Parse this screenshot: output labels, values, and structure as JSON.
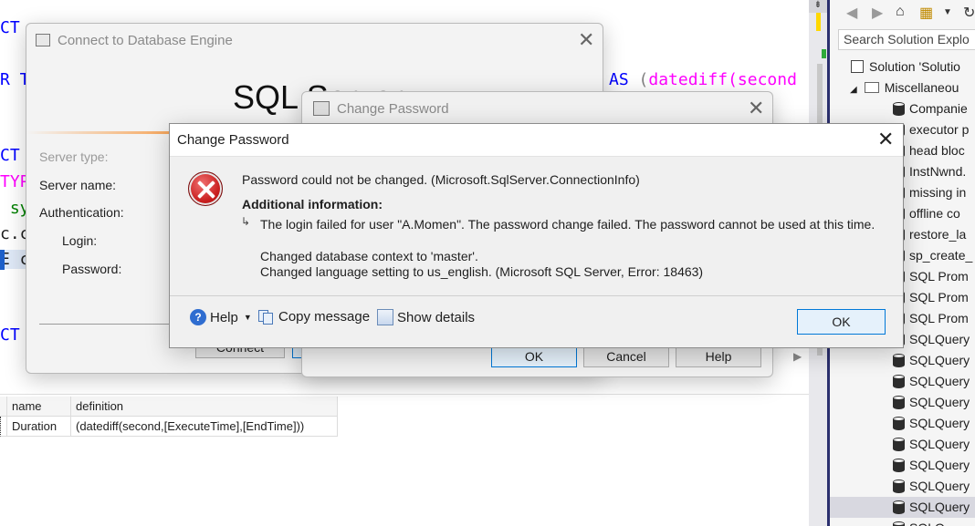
{
  "editor": {
    "code_lines": [
      {
        "text": "CT",
        "cls": "kw"
      },
      {
        "text": "R T",
        "cls": "kw"
      },
      {
        "text": "CT",
        "cls": "kw"
      },
      {
        "text": "TYP",
        "cls": "fn"
      },
      {
        "text": " sy",
        "cls": "green"
      },
      {
        "text": "c.c",
        "cls": "dark"
      },
      {
        "text": "E c",
        "cls": "dark"
      },
      {
        "text": "CT",
        "cls": "kw"
      }
    ],
    "as_keyword": "AS",
    "paren": "(",
    "datediff_fn": "datediff(",
    "second_token": "second"
  },
  "results": {
    "columns": [
      "name",
      "definition"
    ],
    "rows": [
      [
        "Duration",
        "(datediff(second,[ExecuteTime],[EndTime]))"
      ]
    ]
  },
  "solution_explorer": {
    "search_placeholder": "Search Solution Explo",
    "root": "Solution 'Solutio",
    "folder": "Miscellaneou",
    "items": [
      "Companie",
      "executor p",
      "head bloc",
      "InstNwnd.",
      "missing in",
      "offline co",
      "restore_la",
      "sp_create_",
      "SQL Prom",
      "SQL Prom",
      "SQL Prom",
      "SQLQuery",
      "SQLQuery",
      "SQLQuery",
      "SQLQuery",
      "SQLQuery",
      "SQLQuery",
      "SQLQuery",
      "SQLQuery",
      "SQLQuery",
      "SQLQ"
    ]
  },
  "connect_dialog": {
    "title": "Connect to Database Engine",
    "brand": "SQL Server",
    "labels": {
      "server_type": "Server type:",
      "server_name": "Server name:",
      "authentication": "Authentication:",
      "login": "Login:",
      "password": "Password:"
    },
    "connect_button": "Connect"
  },
  "change_password_bg": {
    "title": "Change Password",
    "ok": "OK",
    "cancel": "Cancel",
    "help": "Help"
  },
  "error_dialog": {
    "title": "Change Password",
    "message": "Password could not be changed. (Microsoft.SqlServer.ConnectionInfo)",
    "additional_header": "Additional information:",
    "detail": "The login failed for user \"A.Momen\". The password change failed. The password cannot be used at this time.",
    "context_line1": "Changed database context to 'master'.",
    "context_line2": "Changed language setting to us_english. (Microsoft SQL Server, Error: 18463)",
    "help_label": "Help",
    "copy_label": "Copy message",
    "details_label": "Show details",
    "ok_label": "OK"
  }
}
